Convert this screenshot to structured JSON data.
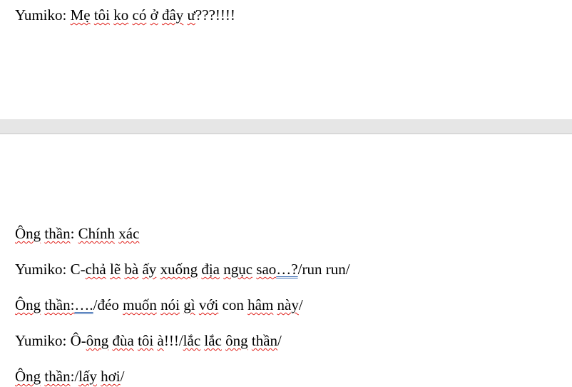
{
  "page1": {
    "line1": {
      "speaker": "Yumiko:",
      "w1": "Mẹ",
      "w2": "tôi",
      "w3": "ko",
      "w4": "có",
      "w5": "ở",
      "w6": "đây",
      "w7": "ư",
      "end": "???!!!!"
    }
  },
  "page2": {
    "line1": {
      "speaker_a": "Ông",
      "speaker_b": "thần",
      "colon": ":",
      "w1": "Chính",
      "w2": "xác"
    },
    "line2": {
      "speaker": "Yumiko:",
      "w1": "C-",
      "w2": "chả",
      "w3": "lẽ",
      "w4": "bà",
      "w5": "ấy",
      "w6": "xuống",
      "w7": "địa",
      "w8": "ngục",
      "w9": "sao",
      "w10": "…?",
      "end": "/run run/"
    },
    "line3": {
      "speaker_a": "Ông",
      "speaker_b": "thần:",
      "ellipsis": "….",
      "w1": "/đéo",
      "w2": "muốn",
      "w3": "nói",
      "w4": "gì",
      "w5": "với",
      "w6": "con",
      "w7": "hâm",
      "w8": "này",
      "end": "/"
    },
    "line4": {
      "speaker": "Yumiko:",
      "w1": "Ô-",
      "w2": "ông",
      "w3": "đùa",
      "w4": "tôi",
      "w5": "à",
      "w6": "!!!/",
      "w7": "lắc",
      "w8": "lắc",
      "w9": "ông",
      "w10": "thần",
      "end": "/"
    },
    "line5": {
      "speaker_a": "Ông",
      "speaker_b": "thần",
      "w1": ":/",
      "w2": "lấy",
      "w3": "hơi",
      "end": "/"
    }
  }
}
